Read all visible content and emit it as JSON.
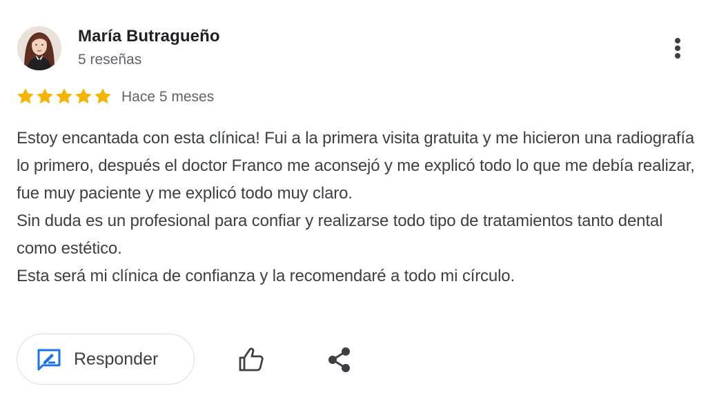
{
  "review": {
    "author_name": "María Butragueño",
    "author_reviews": "5 reseñas",
    "rating": 5,
    "rating_max": 5,
    "date": "Hace 5 meses",
    "paragraphs": [
      "Estoy encantada con esta clínica! Fui a la primera visita gratuita y me hicieron una radiografía lo primero, después el doctor Franco me aconsejó y me explicó todo lo que me debía realizar, fue muy paciente y me explicó todo muy claro.",
      "Sin duda es un profesional para confiar y realizarse todo tipo de tratamientos tanto dental como estético.",
      "Esta será mi clínica de confianza y la recomendaré a todo mi círculo."
    ]
  },
  "actions": {
    "reply_label": "Responder",
    "reply_icon": "rate-review-icon",
    "like_icon": "thumb-up-icon",
    "share_icon": "share-icon",
    "more_icon": "more-vert-icon"
  },
  "colors": {
    "star": "#f4b400",
    "reply_icon": "#1a73e8",
    "text": "#3c4043",
    "secondary_text": "#5f6368",
    "border": "#dadce0"
  }
}
